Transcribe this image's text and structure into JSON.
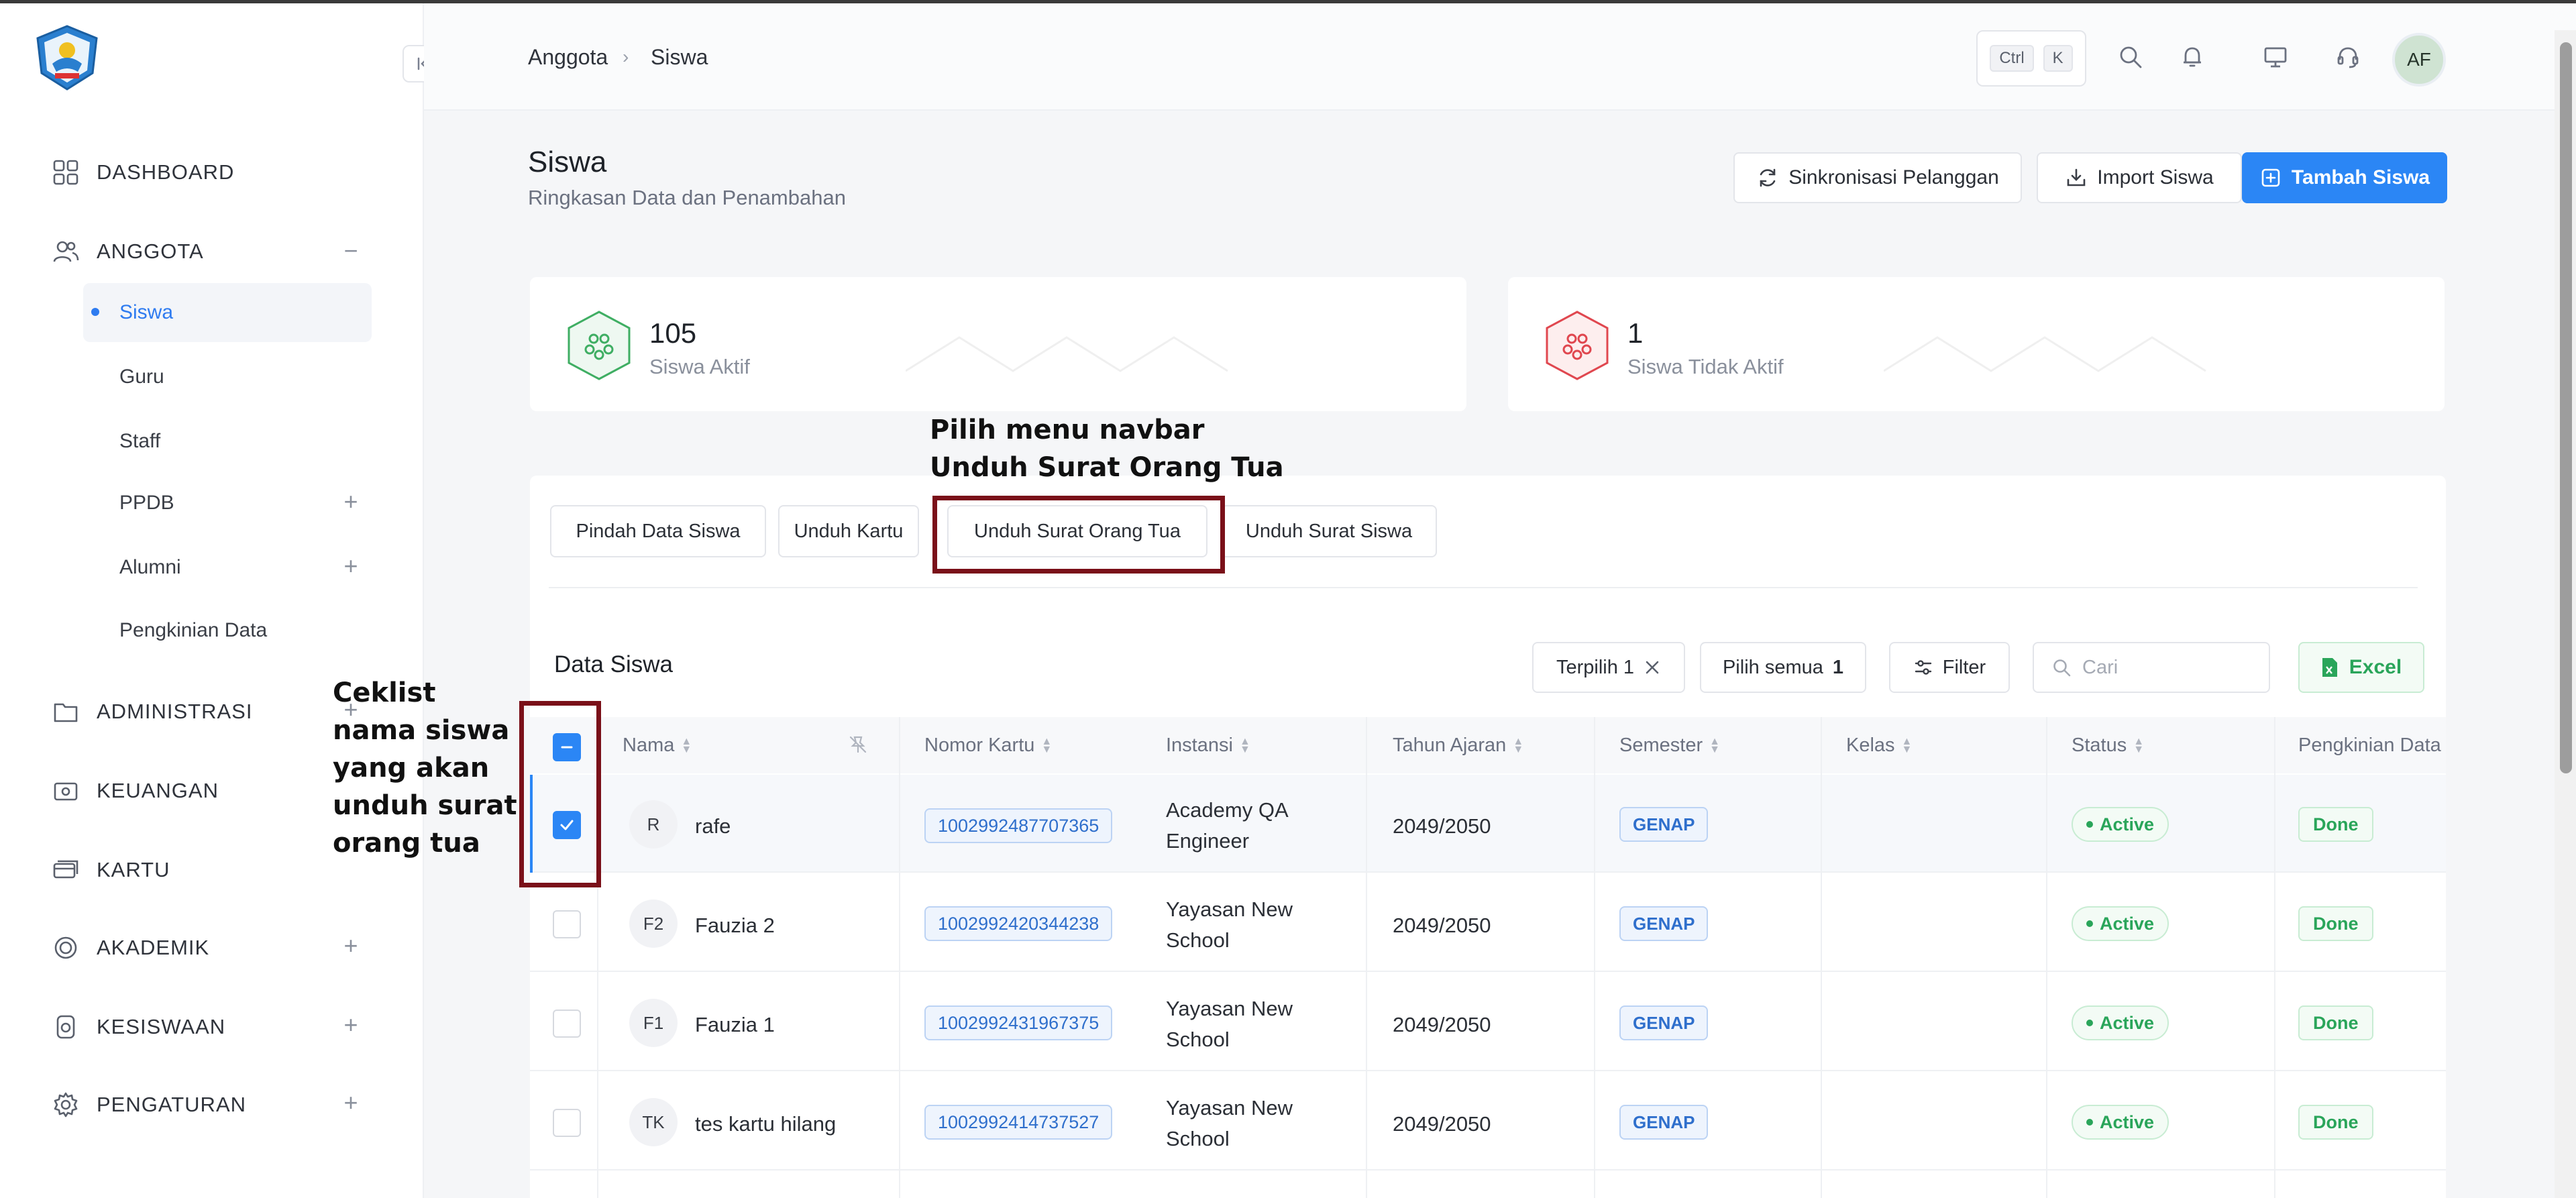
{
  "sidebar": {
    "logo": "tut-wuri-handayani-logo",
    "items": [
      {
        "label": "DASHBOARD",
        "icon": "grid-icon"
      },
      {
        "label": "ANGGOTA",
        "icon": "users-icon",
        "toggle": "−"
      },
      {
        "label": "ADMINISTRASI",
        "icon": "folder-icon",
        "toggle": "+"
      },
      {
        "label": "KEUANGAN",
        "icon": "wallet-icon"
      },
      {
        "label": "KARTU",
        "icon": "card-icon"
      },
      {
        "label": "AKADEMIK",
        "icon": "badge-icon",
        "toggle": "+"
      },
      {
        "label": "KESISWAAN",
        "icon": "student-icon",
        "toggle": "+"
      },
      {
        "label": "PENGATURAN",
        "icon": "gear-icon",
        "toggle": "+"
      }
    ],
    "sub_items": [
      {
        "label": "Siswa",
        "active": true
      },
      {
        "label": "Guru"
      },
      {
        "label": "Staff"
      },
      {
        "label": "PPDB",
        "toggle": "+"
      },
      {
        "label": "Alumni",
        "toggle": "+"
      },
      {
        "label": "Pengkinian Data"
      }
    ]
  },
  "topbar": {
    "breadcrumb": [
      "Anggota",
      "Siswa"
    ],
    "separator": "›",
    "shortcut_keys": [
      "Ctrl",
      "K"
    ],
    "avatar_initials": "AF"
  },
  "header": {
    "title": "Siswa",
    "subtitle": "Ringkasan Data dan Penambahan",
    "buttons": {
      "sync": "Sinkronisasi Pelanggan",
      "import": "Import Siswa",
      "add": "Tambah Siswa"
    }
  },
  "stats": [
    {
      "value": "105",
      "label": "Siswa Aktif",
      "color": "#3fae63"
    },
    {
      "value": "1",
      "label": "Siswa Tidak Aktif",
      "color": "#e0474f"
    }
  ],
  "tabs": [
    "Pindah Data Siswa",
    "Unduh Kartu",
    "Unduh Surat Orang Tua",
    "Unduh Surat Siswa"
  ],
  "annotations": {
    "tab_note": "Pilih menu navbar Unduh Surat Orang Tua",
    "checkbox_note": "Ceklist nama siswa yang akan unduh surat orang tua"
  },
  "table": {
    "section_title": "Data Siswa",
    "selected_label": "Terpilih 1",
    "select_all_label": "Pilih semua",
    "select_all_count": "1",
    "filter_label": "Filter",
    "search_placeholder": "Cari",
    "excel_label": "Excel",
    "columns": [
      "Nama",
      "Nomor Kartu",
      "Instansi",
      "Tahun Ajaran",
      "Semester",
      "Kelas",
      "Status",
      "Pengkinian Data"
    ],
    "rows": [
      {
        "checked": true,
        "initials": "R",
        "name": "rafe",
        "card": "1002992487707365",
        "instansi": [
          "Academy QA",
          "Engineer"
        ],
        "tahun": "2049/2050",
        "semester": "GENAP",
        "kelas": "",
        "status": "Active",
        "pengkinian": "Done"
      },
      {
        "checked": false,
        "initials": "F2",
        "name": "Fauzia 2",
        "card": "1002992420344238",
        "instansi": [
          "Yayasan New",
          "School"
        ],
        "tahun": "2049/2050",
        "semester": "GENAP",
        "kelas": "",
        "status": "Active",
        "pengkinian": "Done"
      },
      {
        "checked": false,
        "initials": "F1",
        "name": "Fauzia 1",
        "card": "1002992431967375",
        "instansi": [
          "Yayasan New",
          "School"
        ],
        "tahun": "2049/2050",
        "semester": "GENAP",
        "kelas": "",
        "status": "Active",
        "pengkinian": "Done"
      },
      {
        "checked": false,
        "initials": "TK",
        "name": "tes kartu hilang",
        "card": "1002992414737527",
        "instansi": [
          "Yayasan New",
          "School"
        ],
        "tahun": "2049/2050",
        "semester": "GENAP",
        "kelas": "",
        "status": "Active",
        "pengkinian": "Done"
      }
    ]
  },
  "colors": {
    "accent": "#2b86f5",
    "annotation": "#7a1019",
    "success": "#2aa55a"
  }
}
